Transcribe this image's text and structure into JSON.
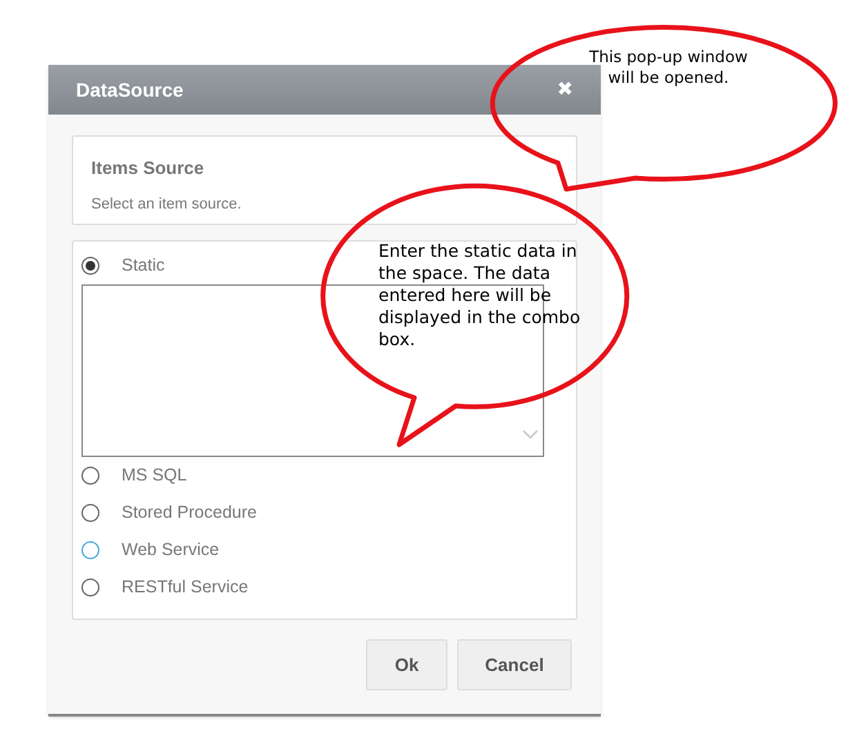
{
  "dialog": {
    "title": "DataSource",
    "close": "✖",
    "items_source": {
      "title": "Items Source",
      "hint": "Select an item source."
    },
    "sources": [
      {
        "label": "Static",
        "selected": true,
        "color": "#666666"
      },
      {
        "label": "MS SQL",
        "selected": false,
        "color": "#666666"
      },
      {
        "label": "Stored Procedure",
        "selected": false,
        "color": "#666666"
      },
      {
        "label": "Web Service",
        "selected": false,
        "color": "#4aa8e0"
      },
      {
        "label": "RESTful Service",
        "selected": false,
        "color": "#666666"
      }
    ],
    "buttons": [
      "Ok",
      "Cancel"
    ]
  },
  "callouts": [
    "This pop-up window\nwill be opened.",
    "Enter the static data in\nthe space. The data\nentered here will be\ndisplayed in the combo\nbox."
  ]
}
